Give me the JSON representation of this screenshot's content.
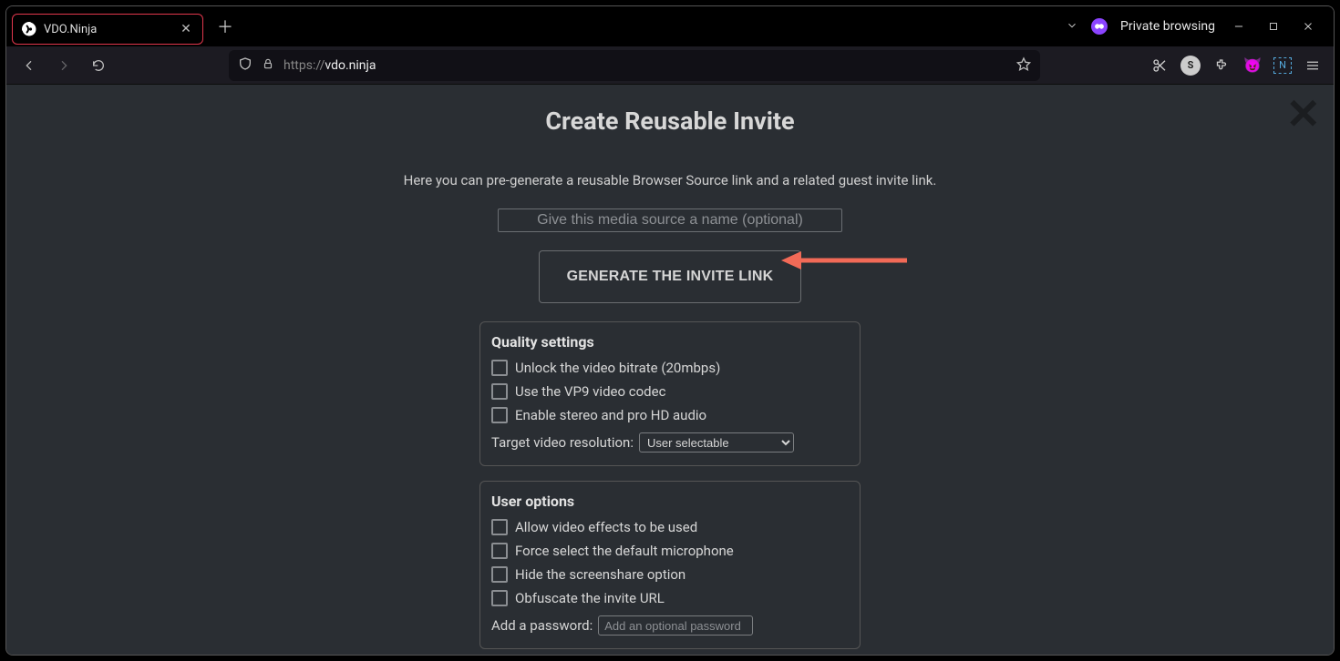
{
  "browser": {
    "tab_title": "VDO.Ninja",
    "private_label": "Private browsing",
    "url_prefix": "https://",
    "url_host": "vdo.ninja"
  },
  "page": {
    "title": "Create Reusable Invite",
    "subtitle": "Here you can pre-generate a reusable Browser Source link and a related guest invite link.",
    "name_placeholder": "Give this media source a name (optional)",
    "generate_button": "GENERATE THE INVITE LINK"
  },
  "quality": {
    "heading": "Quality settings",
    "opts": [
      "Unlock the video bitrate (20mbps)",
      "Use the VP9 video codec",
      "Enable stereo and pro HD audio"
    ],
    "resolution_label": "Target video resolution:",
    "resolution_value": "User selectable"
  },
  "user": {
    "heading": "User options",
    "opts": [
      "Allow video effects to be used",
      "Force select the default microphone",
      "Hide the screenshare option",
      "Obfuscate the invite URL"
    ],
    "password_label": "Add a password:",
    "password_placeholder": "Add an optional password"
  }
}
